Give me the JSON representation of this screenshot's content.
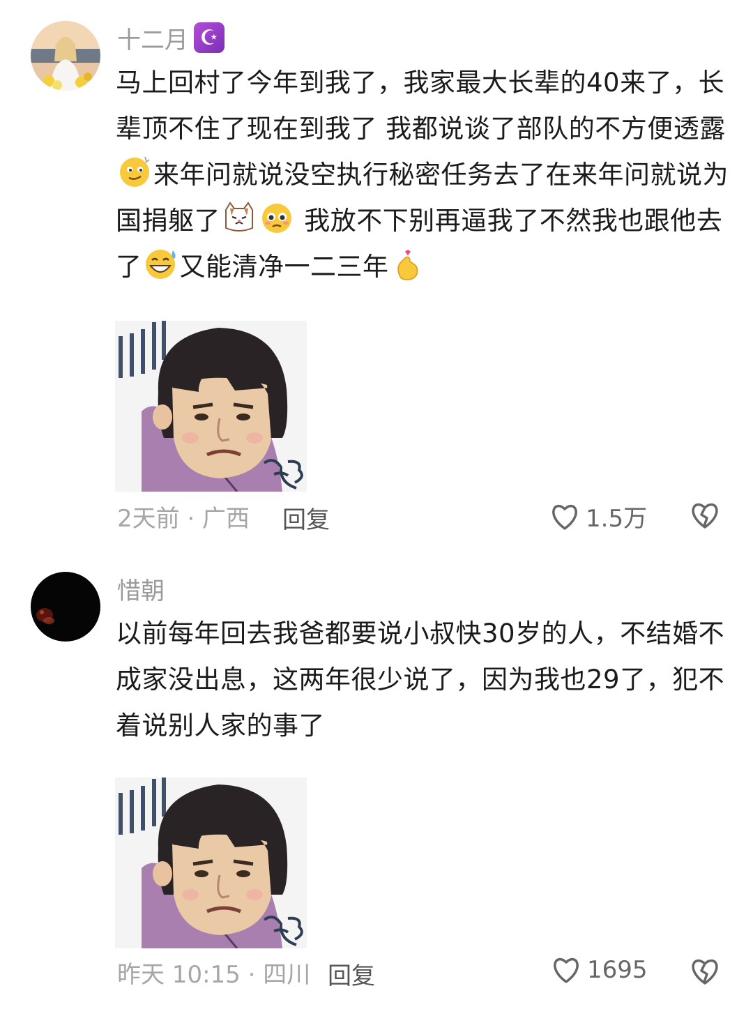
{
  "comments": [
    {
      "username": "十二月",
      "badge_glyph": "☪",
      "text": [
        "马上回村了今年到我了，我家最大长辈的40来了，长辈顶不住了现在到我了 我都说谈了部队的不方便透露",
        "来年问就说没空执行秘密任务去了在来年问就说为国捐躯了",
        " 我放不下别再逼我了不然我也跟他去了",
        "又能清净一二三年"
      ],
      "meta": "2天前 · 广西",
      "reply_label": "回复",
      "likes": "1.5万"
    },
    {
      "username": "惜朝",
      "text": [
        "以前每年回去我爸都要说小叔快30岁的人，不结婚不成家没出息，这两年很少说了，因为我也29了，犯不着说别人家的事了"
      ],
      "meta": "昨天 10:15 · 四川",
      "reply_label": "回复",
      "likes": "1695"
    }
  ],
  "colors": {
    "sticker_sweater": "#a97fb0",
    "badge": "#9a3fc9"
  },
  "icons": [
    "heart-outline-icon",
    "broken-heart-icon",
    "moon-star-badge-icon"
  ]
}
